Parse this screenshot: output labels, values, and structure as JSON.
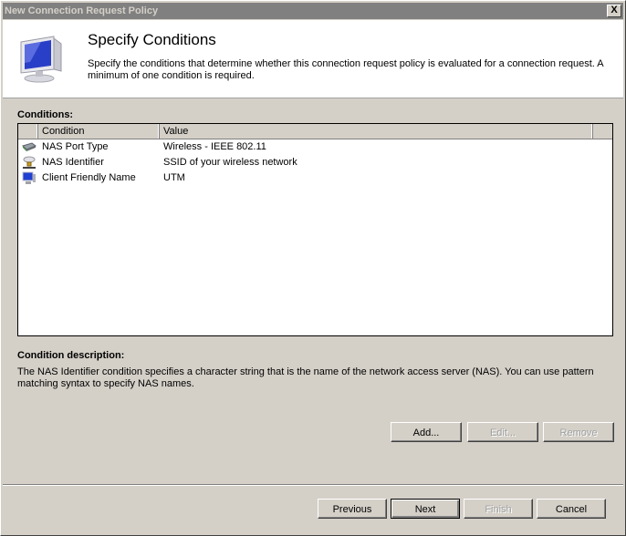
{
  "window": {
    "title": "New Connection Request Policy",
    "close_label": "X"
  },
  "header": {
    "title": "Specify Conditions",
    "subtitle": "Specify the conditions that determine whether this connection request policy is evaluated for a connection request. A minimum of one condition is required.",
    "icon": "computer-monitor-icon"
  },
  "conditions": {
    "label": "Conditions:",
    "columns": [
      "Condition",
      "Value"
    ],
    "rows": [
      {
        "icon": "network-card-icon",
        "condition": "NAS Port Type",
        "value": "Wireless - IEEE 802.11"
      },
      {
        "icon": "network-server-icon",
        "condition": "NAS Identifier",
        "value": "SSID of your wireless network"
      },
      {
        "icon": "client-computer-icon",
        "condition": "Client Friendly Name",
        "value": "UTM"
      }
    ]
  },
  "description": {
    "label": "Condition description:",
    "text": "The NAS Identifier condition specifies a character string that is the name of the network access server (NAS). You can use pattern matching syntax to specify NAS names."
  },
  "condition_buttons": {
    "add": "Add...",
    "edit": "Edit...",
    "remove": "Remove"
  },
  "wizard_buttons": {
    "previous": "Previous",
    "next": "Next",
    "finish": "Finish",
    "cancel": "Cancel"
  }
}
